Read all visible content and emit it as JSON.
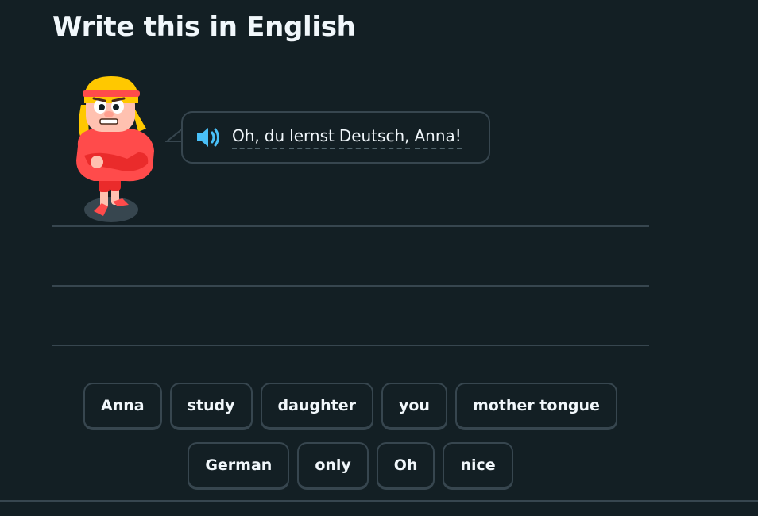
{
  "header": {
    "title": "Write this in English"
  },
  "prompt": {
    "words": [
      "Oh,",
      "du",
      "lernst",
      "Deutsch,",
      "Anna!"
    ],
    "speaker_icon": "speaker-icon"
  },
  "word_bank": {
    "row1": [
      "Anna",
      "study",
      "daughter",
      "you",
      "mother tongue"
    ],
    "row2": [
      "German",
      "only",
      "Oh",
      "nice"
    ]
  },
  "colors": {
    "background": "#131f24",
    "border": "#37464f",
    "text": "#f1f7fb",
    "speaker": "#49c0f8",
    "character_shirt": "#ff4b4b",
    "character_hair": "#ffc800"
  }
}
